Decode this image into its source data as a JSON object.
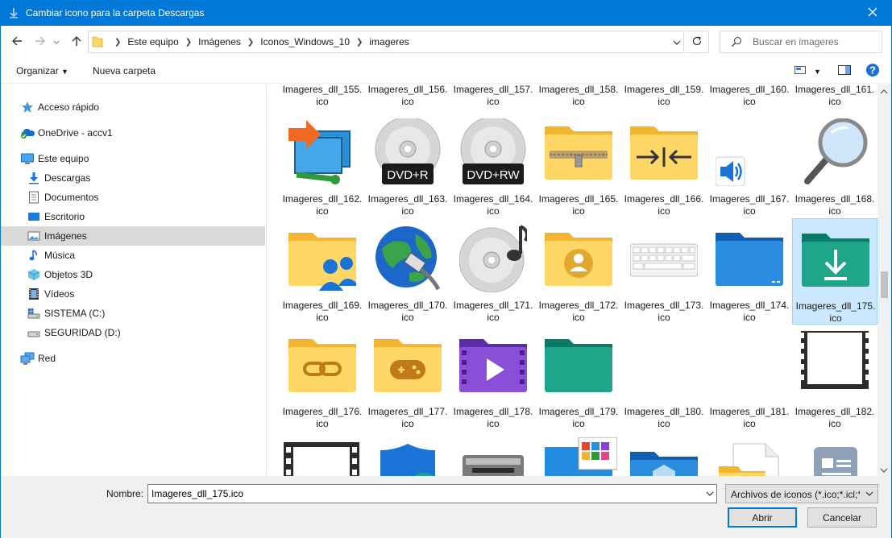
{
  "window": {
    "title": "Cambiar icono para la carpeta Descargas",
    "accent": "#0078d7",
    "close_icon": "close-icon"
  },
  "nav": {
    "back": "back-arrow-icon",
    "forward": "forward-arrow-icon",
    "recent": "chevron-down-icon",
    "up": "up-arrow-icon",
    "breadcrumbs": [
      "Este equipo",
      "Imágenes",
      "Iconos_Windows_10",
      "imageres"
    ],
    "search_placeholder": "Buscar en imageres"
  },
  "commands": {
    "organize": "Organizar",
    "new_folder": "Nueva carpeta"
  },
  "sidebar": {
    "items": [
      {
        "label": "Acceso rápido",
        "icon": "star-icon"
      },
      {
        "label": "OneDrive - accv1",
        "icon": "onedrive-icon"
      },
      {
        "label": "Este equipo",
        "icon": "computer-icon"
      },
      {
        "label": "Descargas",
        "icon": "download-icon"
      },
      {
        "label": "Documentos",
        "icon": "document-icon"
      },
      {
        "label": "Escritorio",
        "icon": "desktop-icon"
      },
      {
        "label": "Imágenes",
        "icon": "pictures-icon"
      },
      {
        "label": "Música",
        "icon": "music-icon"
      },
      {
        "label": "Objetos 3D",
        "icon": "cube-icon"
      },
      {
        "label": "Vídeos",
        "icon": "video-icon"
      },
      {
        "label": "SISTEMA (C:)",
        "icon": "drive-icon"
      },
      {
        "label": "SEGURIDAD (D:)",
        "icon": "drive-icon"
      },
      {
        "label": "Red",
        "icon": "network-icon"
      }
    ]
  },
  "files": [
    {
      "l1": "Imageres_dll_155.",
      "l2": "ico"
    },
    {
      "l1": "Imageres_dll_156.",
      "l2": "ico"
    },
    {
      "l1": "Imageres_dll_157.",
      "l2": "ico"
    },
    {
      "l1": "Imageres_dll_158.",
      "l2": "ico"
    },
    {
      "l1": "Imageres_dll_159.",
      "l2": "ico"
    },
    {
      "l1": "Imageres_dll_160.",
      "l2": "ico"
    },
    {
      "l1": "Imageres_dll_161.",
      "l2": "ico"
    },
    {
      "l1": "Imageres_dll_162.",
      "l2": "ico",
      "icon": "network-share-icon"
    },
    {
      "l1": "Imageres_dll_163.",
      "l2": "ico",
      "icon": "dvd-r-icon",
      "badge": "DVD+R"
    },
    {
      "l1": "Imageres_dll_164.",
      "l2": "ico",
      "icon": "dvd-rw-icon",
      "badge": "DVD+RW"
    },
    {
      "l1": "Imageres_dll_165.",
      "l2": "ico",
      "icon": "zip-folder-icon"
    },
    {
      "l1": "Imageres_dll_166.",
      "l2": "ico",
      "icon": "compress-folder-icon"
    },
    {
      "l1": "Imageres_dll_167.",
      "l2": "ico",
      "icon": "speaker-icon"
    },
    {
      "l1": "Imageres_dll_168.",
      "l2": "ico",
      "icon": "magnifier-icon"
    },
    {
      "l1": "Imageres_dll_169.",
      "l2": "ico",
      "icon": "users-folder-icon"
    },
    {
      "l1": "Imageres_dll_170.",
      "l2": "ico",
      "icon": "globe-network-icon"
    },
    {
      "l1": "Imageres_dll_171.",
      "l2": "ico",
      "icon": "music-cd-icon"
    },
    {
      "l1": "Imageres_dll_172.",
      "l2": "ico",
      "icon": "user-folder-icon"
    },
    {
      "l1": "Imageres_dll_173.",
      "l2": "ico",
      "icon": "keyboard-icon"
    },
    {
      "l1": "Imageres_dll_174.",
      "l2": "ico",
      "icon": "blue-folder-icon"
    },
    {
      "l1": "Imageres_dll_175.",
      "l2": "ico",
      "icon": "downloads-folder-icon",
      "selected": true
    },
    {
      "l1": "Imageres_dll_176.",
      "l2": "ico",
      "icon": "link-folder-icon"
    },
    {
      "l1": "Imageres_dll_177.",
      "l2": "ico",
      "icon": "games-folder-icon"
    },
    {
      "l1": "Imageres_dll_178.",
      "l2": "ico",
      "icon": "video-folder-icon"
    },
    {
      "l1": "Imageres_dll_179.",
      "l2": "ico",
      "icon": "green-folder-icon"
    },
    {
      "l1": "Imageres_dll_180.",
      "l2": "ico",
      "icon": "blank-icon"
    },
    {
      "l1": "Imageres_dll_181.",
      "l2": "ico",
      "icon": "blank-frame-icon"
    },
    {
      "l1": "Imageres_dll_182.",
      "l2": "ico",
      "icon": "film-frame-icon"
    }
  ],
  "partial_row_icons": [
    "film-frame-icon",
    "shield-icon",
    "printer-icon",
    "app-window-icon",
    "3d-folder-icon",
    "document-folder-icon",
    "news-icon"
  ],
  "footer": {
    "name_label": "Nombre:",
    "name_value": "Imageres_dll_175.ico",
    "file_type": "Archivos de iconos (*.ico;*.icl;*.",
    "open_button": "Abrir",
    "cancel_button": "Cancelar"
  }
}
